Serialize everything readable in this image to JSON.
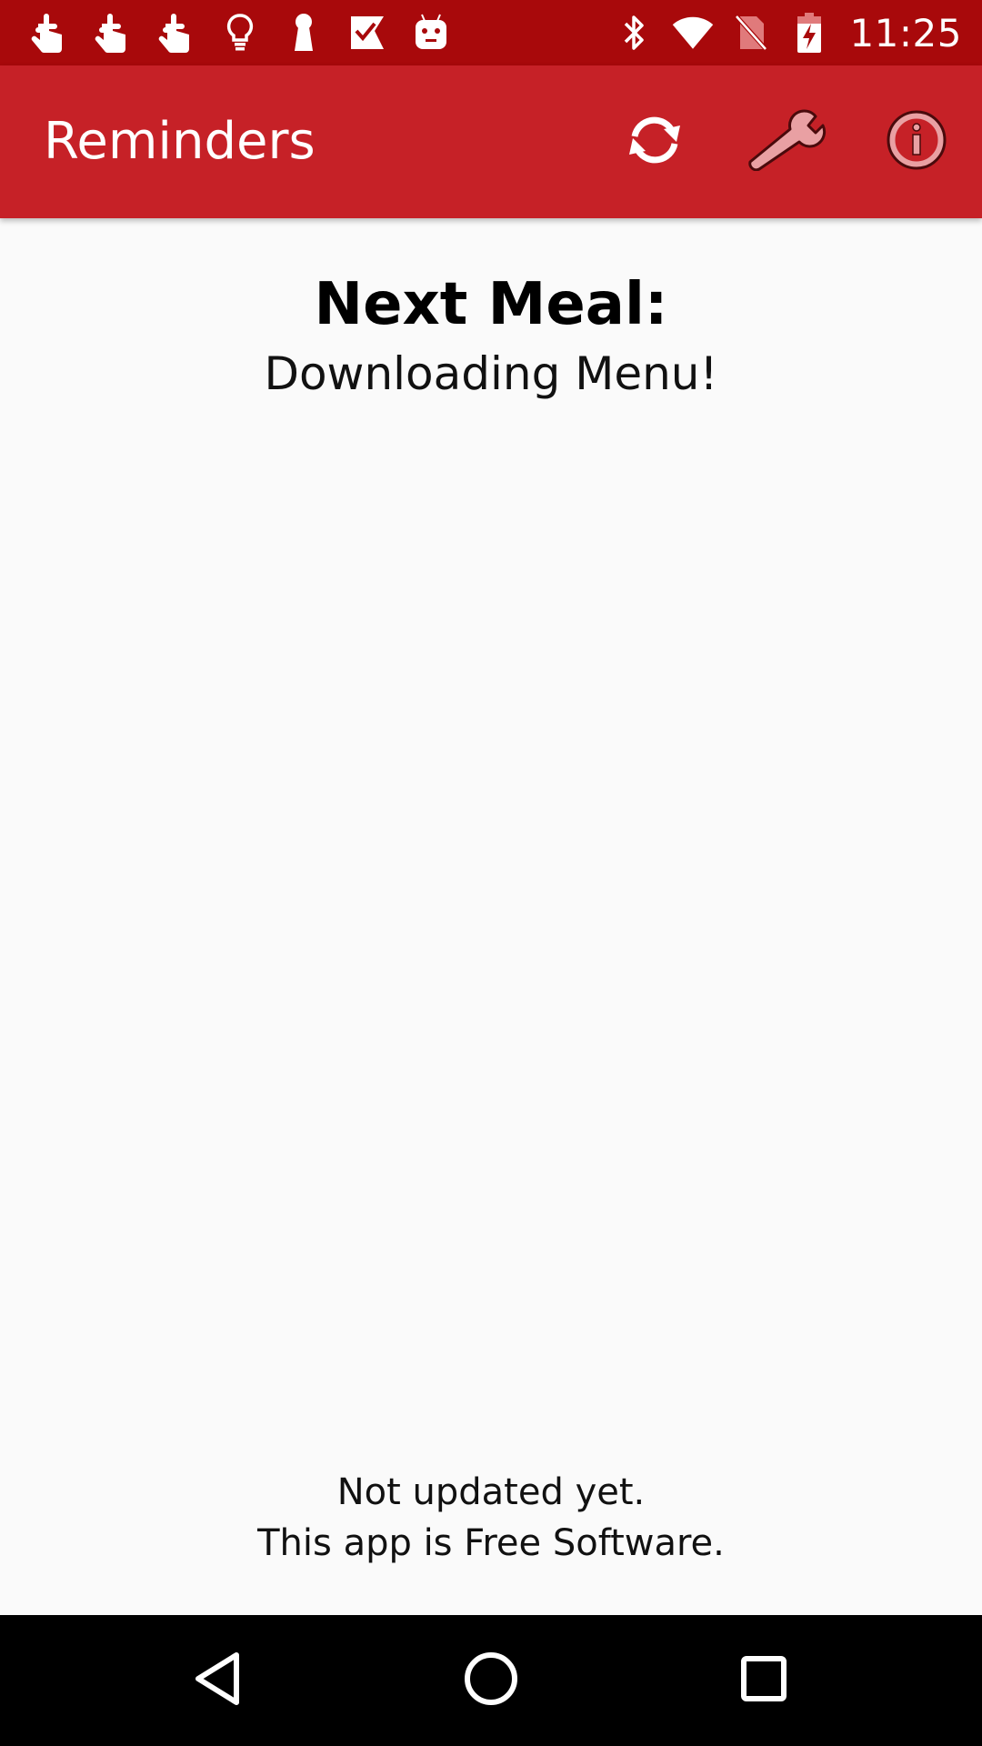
{
  "status_bar": {
    "time": "11:25",
    "notification_icons": [
      "touch-icon",
      "touch-icon",
      "touch-icon",
      "lightbulb-icon",
      "keyhole-icon",
      "check-flag-icon",
      "android-icon"
    ],
    "system_icons": [
      "bluetooth-icon",
      "wifi-icon",
      "no-sim-icon",
      "battery-charging-icon"
    ]
  },
  "app_bar": {
    "title": "Reminders",
    "actions": [
      "refresh-icon",
      "wrench-icon",
      "info-icon"
    ]
  },
  "main": {
    "heading": "Next Meal:",
    "menu_status": "Downloading Menu!"
  },
  "footer": {
    "update_status": "Not updated yet.",
    "license_note": "This app is Free Software."
  },
  "colors": {
    "status_bar": "#a8090b",
    "app_bar": "#c62127",
    "background": "#fafafa",
    "nav_bar": "#000000"
  }
}
